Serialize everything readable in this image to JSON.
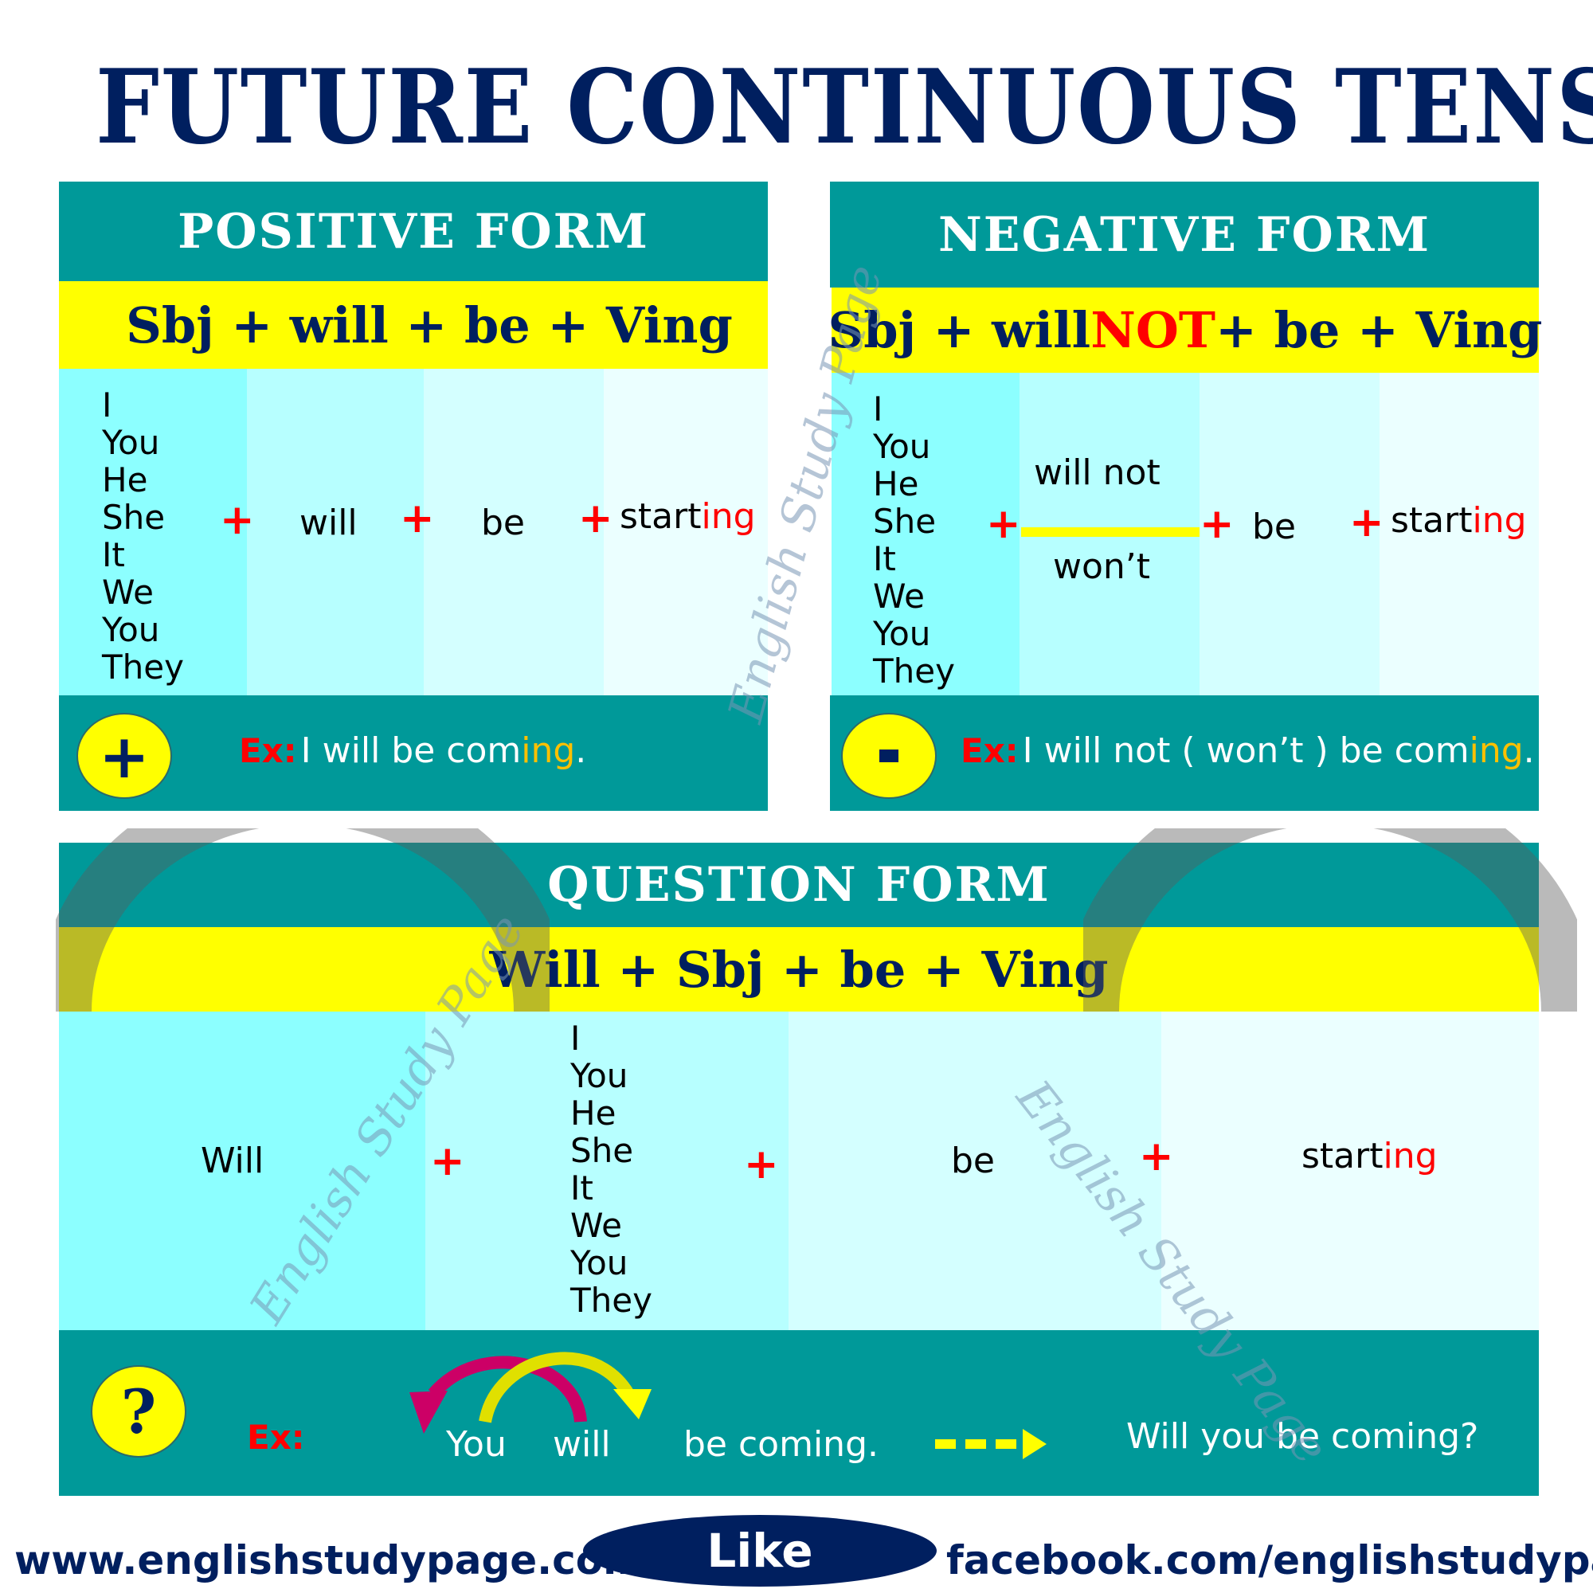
{
  "title": "FUTURE CONTINUOUS TENSE",
  "subjects": [
    "I",
    "You",
    "He",
    "She",
    "It",
    "We",
    "You",
    "They"
  ],
  "positive": {
    "header": "POSITIVE FORM",
    "formula": "Sbj + will + be + Ving",
    "plus": "+",
    "aux": "will",
    "be": "be",
    "verb_stem": "start",
    "verb_suffix": "ing",
    "badge_symbol": "+",
    "example_label": "Ex:",
    "example_main": "I will be com",
    "example_suffix": "ing",
    "example_end": "."
  },
  "negative": {
    "header": "NEGATIVE FORM",
    "formula_start": "Sbj + will ",
    "formula_highlight": "NOT",
    "formula_end": " + be + Ving",
    "plus": "+",
    "aux_full": "will not",
    "aux_short": "won’t",
    "be": "be",
    "verb_stem": "start",
    "verb_suffix": "ing",
    "badge_symbol": "-",
    "example_label": "Ex:",
    "example_main": "I will not ( won’t ) be com",
    "example_suffix": "ing",
    "example_end": "."
  },
  "question": {
    "header": "QUESTION FORM",
    "formula": "Will +  Sbj + be + Ving",
    "plus": "+",
    "aux": "Will",
    "be": "be",
    "verb_stem": "start",
    "verb_suffix": "ing",
    "badge_symbol": "?",
    "example_label": "Ex:",
    "example_you": "You",
    "example_will": "will",
    "example_rest": "be coming.",
    "example_result": "Will you be coming?"
  },
  "watermarks": {
    "text": "English Study Page",
    "arc_text": "www.englishstudypage.com"
  },
  "footer": {
    "website": "www.englishstudypage.com",
    "like_label": "Like",
    "facebook": "facebook.com/englishstudypage"
  },
  "colors": {
    "navy": "#001f5f",
    "teal": "#009999",
    "yellow": "#ffff00",
    "red": "#ff0000",
    "orange": "#ffc000",
    "magenta": "#cc0066"
  }
}
